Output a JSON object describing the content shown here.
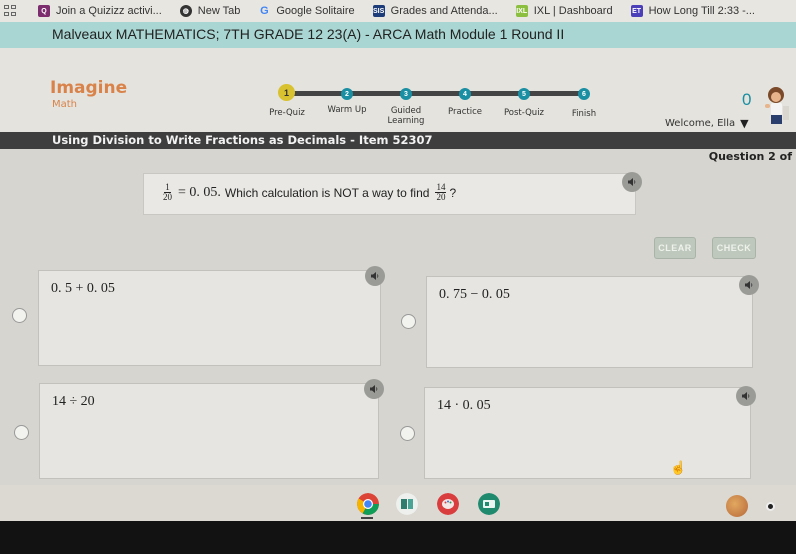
{
  "bookmarks": [
    {
      "label": "Join a Quizizz activi...",
      "icon": "quizizz-icon",
      "color": "#7b2d6e"
    },
    {
      "label": "New Tab",
      "icon": "globe-icon",
      "color": "#333333"
    },
    {
      "label": "Google Solitaire",
      "icon": "google-icon",
      "color": "#4285f4"
    },
    {
      "label": "Grades and Attenda...",
      "icon": "sis-icon",
      "color": "#1d3c7a"
    },
    {
      "label": "IXL | Dashboard",
      "icon": "ixl-icon",
      "color": "#8cbf3f"
    },
    {
      "label": "How Long Till 2:33 -...",
      "icon": "timer-icon",
      "color": "#4a3fb8"
    }
  ],
  "course_title": "Malveaux MATHEMATICS; 7TH GRADE 12 23(A) - ARCA Math Module 1 Round II",
  "logo": {
    "main": "Imagine",
    "sub": "Math"
  },
  "progress_steps": [
    {
      "number": "1",
      "label": "Pre-Quiz",
      "active": true
    },
    {
      "number": "2",
      "label": "Warm Up",
      "active": false
    },
    {
      "number": "3",
      "label": "Guided Learning",
      "active": false
    },
    {
      "number": "4",
      "label": "Practice",
      "active": false
    },
    {
      "number": "5",
      "label": "Post-Quiz",
      "active": false
    },
    {
      "number": "6",
      "label": "Finish",
      "active": false
    }
  ],
  "score": "0",
  "welcome": "Welcome, Ella",
  "item_title": "Using Division to Write Fractions as Decimals - Item 52307",
  "question_count": "Question 2 of",
  "prompt": {
    "frac1_num": "1",
    "frac1_den": "20",
    "equals_part": "= 0. 05.",
    "text": "Which calculation is NOT a way to find",
    "frac2_num": "14",
    "frac2_den": "20",
    "end": "?"
  },
  "buttons": {
    "clear": "CLEAR",
    "check": "CHECK"
  },
  "choices": [
    {
      "expr": "0. 5 + 0. 05"
    },
    {
      "expr": "0. 75 − 0. 05"
    },
    {
      "expr": "14 ÷ 20"
    },
    {
      "expr": "14 · 0. 05"
    }
  ],
  "dock": [
    {
      "name": "chrome-icon",
      "color": "#db4437"
    },
    {
      "name": "forms-icon",
      "color": "#2e7d6e"
    },
    {
      "name": "paint-icon",
      "color": "#d93d3d"
    },
    {
      "name": "classroom-icon",
      "color": "#1f8a6e"
    }
  ]
}
